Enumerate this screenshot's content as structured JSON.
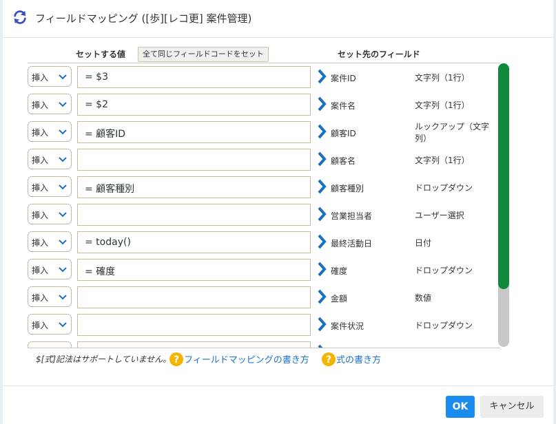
{
  "dialog": {
    "title": "フィールドマッピング ([歩][レコ更] 案件管理)",
    "header_icon": "refresh-icon",
    "accent_color": "#1a73c8"
  },
  "columns": {
    "value_header": "セットする値",
    "same_code_button": "全て同じフィールドコードをセット",
    "target_header": "セット先のフィールド"
  },
  "rows": [
    {
      "mode": "挿入",
      "value": "= $3",
      "field": "案件ID",
      "type": "文字列（1行）"
    },
    {
      "mode": "挿入",
      "value": "= $2",
      "field": "案件名",
      "type": "文字列（1行）"
    },
    {
      "mode": "挿入",
      "value": "= 顧客ID",
      "field": "顧客ID",
      "type": "ルックアップ（文字列）"
    },
    {
      "mode": "挿入",
      "value": "",
      "field": "顧客名",
      "type": "文字列（1行）"
    },
    {
      "mode": "挿入",
      "value": "= 顧客種別",
      "field": "顧客種別",
      "type": "ドロップダウン"
    },
    {
      "mode": "挿入",
      "value": "",
      "field": "営業担当者",
      "type": "ユーザー選択"
    },
    {
      "mode": "挿入",
      "value": "= today()",
      "field": "最終活動日",
      "type": "日付"
    },
    {
      "mode": "挿入",
      "value": "= 確度",
      "field": "確度",
      "type": "ドロップダウン"
    },
    {
      "mode": "挿入",
      "value": "",
      "field": "金額",
      "type": "数値"
    },
    {
      "mode": "挿入",
      "value": "",
      "field": "案件状況",
      "type": "ドロップダウン"
    },
    {
      "mode": "",
      "value": "",
      "field": "",
      "type": ""
    }
  ],
  "scrollbar": {
    "thumb_color": "#0e8a3a",
    "track_color": "#c8c8c8"
  },
  "footer": {
    "note": "$[式]記法はサポートしていません。",
    "link1": "フィールドマッピングの書き方",
    "link2": "式の書き方",
    "help_icon_color": "#f5b400",
    "ok": "OK",
    "cancel": "キャンセル"
  }
}
